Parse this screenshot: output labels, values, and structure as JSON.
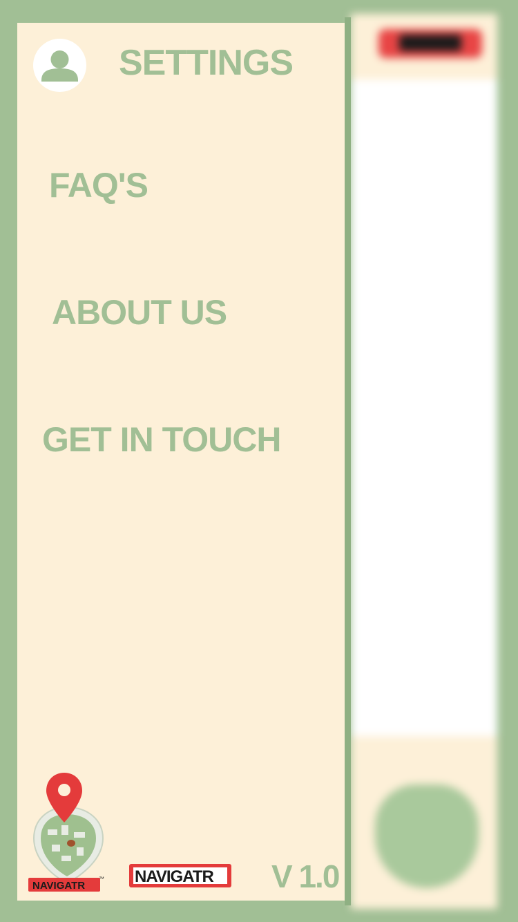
{
  "drawer": {
    "title": "SETTINGS",
    "menu": [
      {
        "label": "FAQ'S"
      },
      {
        "label": "ABOUT US"
      },
      {
        "label": "GET IN TOUCH"
      }
    ]
  },
  "footer": {
    "brand_name": "NAVIGATR",
    "trademark": "™",
    "version": "V 1.0"
  },
  "icons": {
    "avatar": "user-avatar-icon",
    "pin": "map-pin-icon"
  },
  "colors": {
    "frame_green": "#a1bf95",
    "panel_cream": "#fdf0d8",
    "brand_red": "#e43b3b",
    "brand_black": "#1b1b1b"
  }
}
